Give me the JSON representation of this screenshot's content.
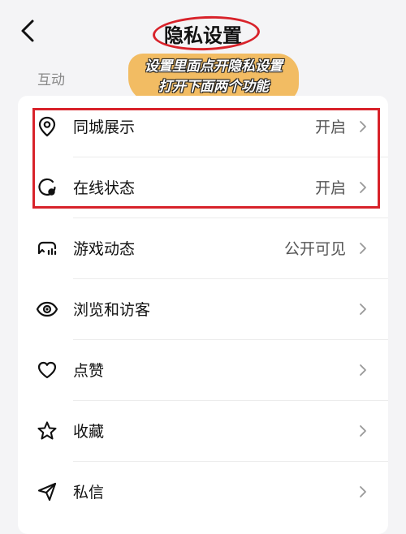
{
  "header": {
    "back_icon": "chevron-left-icon",
    "title": "隐私设置"
  },
  "annotation": {
    "line1": "设置里面点开隐私设置",
    "line2": "打开下面两个功能",
    "bubble_color": "#f1b85b",
    "highlight_color": "#d8222a"
  },
  "section": {
    "label": "互动"
  },
  "items": [
    {
      "label": "同城展示",
      "value": "开启",
      "icon": "location-pin-icon"
    },
    {
      "label": "在线状态",
      "value": "开启",
      "icon": "online-status-icon"
    },
    {
      "label": "游戏动态",
      "value": "公开可见",
      "icon": "game-controller-icon"
    },
    {
      "label": "浏览和访客",
      "value": "",
      "icon": "eye-icon"
    },
    {
      "label": "点赞",
      "value": "",
      "icon": "heart-icon"
    },
    {
      "label": "收藏",
      "value": "",
      "icon": "star-icon"
    },
    {
      "label": "私信",
      "value": "",
      "icon": "send-icon"
    }
  ]
}
